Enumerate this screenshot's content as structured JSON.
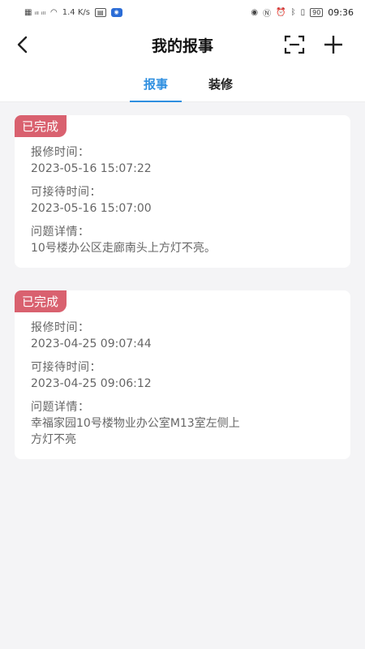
{
  "status_bar": {
    "left_text": "⁴⁶ᵢₗ ⁴⁶ᵢₗ",
    "speed": "1.4 K/s",
    "battery": "90",
    "time": "09:36"
  },
  "navbar": {
    "title": "我的报事"
  },
  "tabs": [
    {
      "label": "报事",
      "active": true
    },
    {
      "label": "装修",
      "active": false
    }
  ],
  "labels": {
    "repair_time": "报修时间：",
    "reception_time": "可接待时间：",
    "issue_detail": "问题详情："
  },
  "reports": [
    {
      "status": "已完成",
      "repair_time": "2023-05-16 15:07:22",
      "reception_time": "2023-05-16 15:07:00",
      "issue_detail": "10号楼办公区走廊南头上方灯不亮。"
    },
    {
      "status": "已完成",
      "repair_time": "2023-04-25 09:07:44",
      "reception_time": "2023-04-25 09:06:12",
      "issue_detail": "幸福家园10号楼物业办公室M13室左侧上方灯不亮"
    }
  ],
  "colors": {
    "accent": "#2f8fe0",
    "status_badge": "#d9616f",
    "background": "#f4f4f6"
  }
}
